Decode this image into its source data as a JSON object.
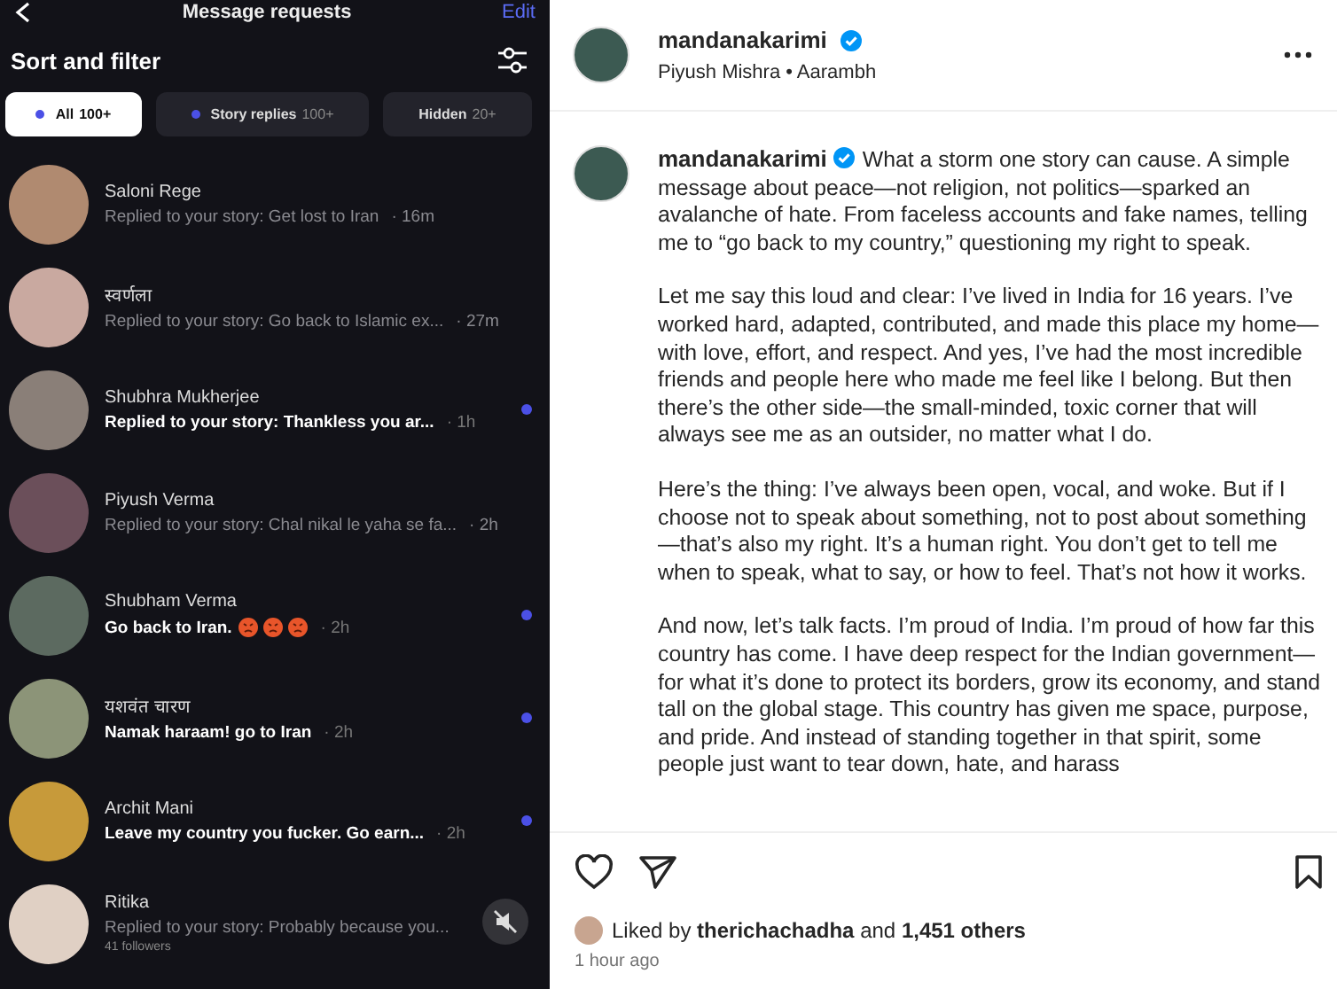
{
  "requests": {
    "title": "Message requests",
    "edit": "Edit",
    "sort_label": "Sort and filter",
    "tabs": [
      {
        "label": "All",
        "count": "100+",
        "dot": true,
        "selected": true
      },
      {
        "label": "Story replies",
        "count": "100+",
        "dot": true,
        "selected": false
      },
      {
        "label": "Hidden",
        "count": "20+",
        "dot": false,
        "selected": false
      }
    ],
    "messages": [
      {
        "name": "Saloni Rege",
        "text": "Replied to your story: Get lost to Iran",
        "time": "· 16m",
        "unread": false,
        "color": "#b08a70"
      },
      {
        "name": "स्वर्णला",
        "text": "Replied to your story: Go back to Islamic ex...",
        "time": "· 27m",
        "unread": false,
        "color": "#c9a9a0"
      },
      {
        "name": "Shubhra Mukherjee",
        "text": "Replied to your story: Thankless you ar...",
        "time": "· 1h",
        "unread": true,
        "color": "#8a7f78"
      },
      {
        "name": "Piyush Verma",
        "text": "Replied to your story: Chal nikal le yaha se fa...",
        "time": "· 2h",
        "unread": false,
        "color": "#6b4f5a"
      },
      {
        "name": "Shubham Verma",
        "text": "Go back to Iran.",
        "angry_emojis": true,
        "time": "· 2h",
        "unread": true,
        "color": "#5c6a60"
      },
      {
        "name": "यशवंत चारण",
        "text": "Namak haraam! go to Iran",
        "time": "· 2h",
        "unread": true,
        "color": "#8c9478"
      },
      {
        "name": "Archit Mani",
        "text": "Leave my country you fucker. Go earn...",
        "time": "· 2h",
        "unread": true,
        "color": "#c79a3a"
      },
      {
        "name": "Ritika",
        "text": "Replied to your story: Probably because you...",
        "followers": "41 followers",
        "unread": false,
        "muted": true,
        "color": "#e0d0c4"
      }
    ]
  },
  "post": {
    "username": "mandanakarimi",
    "verified": true,
    "audio": "Piyush Mishra • Aarambh",
    "caption_username": "mandanakarimi",
    "caption_verified": true,
    "caption": [
      "What a storm one story can cause. A simple message about peace—not religion, not politics—sparked an avalanche of hate. From faceless accounts and fake names, telling me to “go back to my country,” questioning my right to speak.",
      "Let me say this loud and clear: I’ve lived in India for 16 years. I’ve worked hard, adapted, contributed, and made this place my home—with love, effort, and respect. And yes, I’ve had the most incredible friends and people here who made me feel like I belong. But then there’s the other side—the small-minded, toxic corner that will always see me as an outsider, no matter what I do.",
      "Here’s the thing: I’ve always been open, vocal, and woke. But if I choose not to speak about something, not to post about something—that’s also my right. It’s a human right. You don’t get to tell me when to speak, what to say, or how to feel. That’s not how it works.",
      "And now, let’s talk facts. I’m proud of India. I’m proud of how far this country has come. I have deep respect for the Indian government—for what it’s done to protect its borders, grow its economy, and stand tall on the global stage. This country has given me space, purpose, and pride. And instead of standing together in that spirit, some people just want to tear down, hate, and harass"
    ],
    "likes": "Liked by **therichachadha** and **1,451 others**",
    "time": "1 hour ago"
  }
}
